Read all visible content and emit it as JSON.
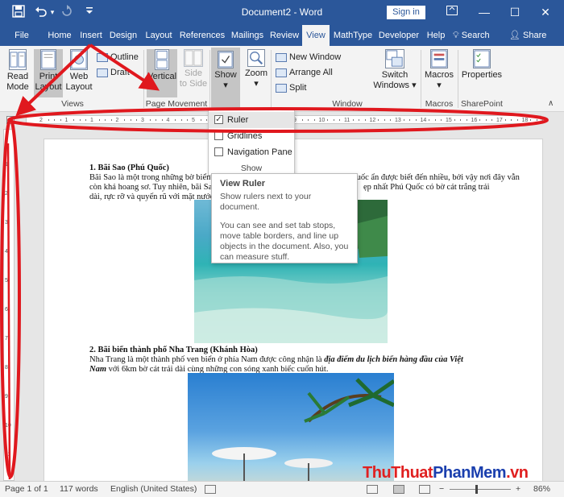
{
  "titlebar": {
    "title": "Document2 - Word",
    "signin": "Sign in",
    "save_icon": "save-icon",
    "undo_icon": "undo-icon",
    "redo_icon": "redo-icon",
    "minimize": "—",
    "maximize": "☐",
    "close": "✕",
    "restore": "▭",
    "accent": "#2b579a"
  },
  "tabs": [
    {
      "label": "File"
    },
    {
      "label": "Home"
    },
    {
      "label": "Insert"
    },
    {
      "label": "Design"
    },
    {
      "label": "Layout"
    },
    {
      "label": "References"
    },
    {
      "label": "Mailings"
    },
    {
      "label": "Review"
    },
    {
      "label": "View"
    },
    {
      "label": "MathType"
    },
    {
      "label": "Developer"
    },
    {
      "label": "Help"
    }
  ],
  "active_tab": "View",
  "tellme": "Search",
  "share": "Share",
  "ribbon": {
    "read_mode": "Read\nMode",
    "print_layout": "Print\nLayout",
    "web_layout": "Web\nLayout",
    "outline": "Outline",
    "draft": "Draft",
    "views_group": "Views",
    "vertical": "Vertical",
    "side_to_side": "Side\nto Side",
    "page_movement_group": "Page Movement",
    "show": "Show",
    "zoom": "Zoom",
    "new_window": "New Window",
    "arrange_all": "Arrange All",
    "split": "Split",
    "window_group": "Window",
    "switch_windows": "Switch\nWindows ▾",
    "macros": "Macros",
    "macros_group": "Macros",
    "properties": "Properties",
    "sharepoint_group": "SharePoint"
  },
  "show_dropdown": {
    "items": [
      {
        "label": "Ruler",
        "checked": true
      },
      {
        "label": "Gridlines",
        "checked": false
      },
      {
        "label": "Navigation Pane",
        "checked": false
      }
    ],
    "group_label": "Show"
  },
  "tooltip": {
    "title": "View Ruler",
    "line1": "Show rulers next to your document.",
    "line2": "You can see and set tab stops, move table borders, and line up objects in the document. Also, you can measure stuff."
  },
  "document": {
    "h1": "1. Bãi Sao (Phú Quốc)",
    "p1a": "Bãi Sao là  một trong những bờ biển",
    "p1b": "Quốc ẩn       được biết đến nhiều, bởi vậy nơi đây vẫn",
    "p2a": "còn khá hoang sơ. Tuy nhiên, bãi Sa",
    "p2b": "ẹp nhất  Phú Quốc có bờ cát trắng trải",
    "p3": "dài, rực rỡ và quyến rũ với mặt nước",
    "h2": "2. Bãi biển thành phố Nha Trang (Khánh Hòa)",
    "p4a": "Nha Trang là một thành phố ven biển ở phía Nam được công nhận là ",
    "p4b": "địa điểm du lịch biển hàng đầu của Việt",
    "p5a": "Nam",
    "p5b": " với 6km bờ cát trải dài cùng những con sóng xanh biếc cuốn hút."
  },
  "statusbar": {
    "page": "Page 1 of 1",
    "words": "117 words",
    "language": "English (United States)",
    "zoom": "86%",
    "zoom_level": 0.86
  },
  "watermark": {
    "part1": "ThuThuat",
    "part2": "PhanMem",
    "part3": ".vn"
  },
  "ruler": {
    "numbers": [
      "2",
      "1",
      "1",
      "2",
      "3",
      "4",
      "5",
      "6",
      "7",
      "8",
      "9",
      "10",
      "11",
      "12",
      "13",
      "14",
      "15",
      "16",
      "17",
      "18"
    ],
    "vnumbers": [
      "1",
      "2",
      "3",
      "4",
      "5",
      "6",
      "7",
      "8",
      "9",
      "10",
      "11"
    ]
  },
  "annotation_color": "#e0181e"
}
